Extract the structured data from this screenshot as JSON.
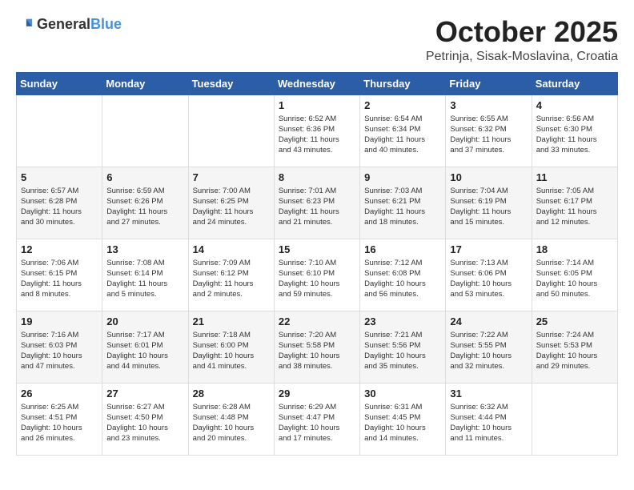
{
  "header": {
    "logo_general": "General",
    "logo_blue": "Blue",
    "month_title": "October 2025",
    "subtitle": "Petrinja, Sisak-Moslavina, Croatia"
  },
  "days_of_week": [
    "Sunday",
    "Monday",
    "Tuesday",
    "Wednesday",
    "Thursday",
    "Friday",
    "Saturday"
  ],
  "weeks": [
    [
      {
        "day": "",
        "info": ""
      },
      {
        "day": "",
        "info": ""
      },
      {
        "day": "",
        "info": ""
      },
      {
        "day": "1",
        "info": "Sunrise: 6:52 AM\nSunset: 6:36 PM\nDaylight: 11 hours\nand 43 minutes."
      },
      {
        "day": "2",
        "info": "Sunrise: 6:54 AM\nSunset: 6:34 PM\nDaylight: 11 hours\nand 40 minutes."
      },
      {
        "day": "3",
        "info": "Sunrise: 6:55 AM\nSunset: 6:32 PM\nDaylight: 11 hours\nand 37 minutes."
      },
      {
        "day": "4",
        "info": "Sunrise: 6:56 AM\nSunset: 6:30 PM\nDaylight: 11 hours\nand 33 minutes."
      }
    ],
    [
      {
        "day": "5",
        "info": "Sunrise: 6:57 AM\nSunset: 6:28 PM\nDaylight: 11 hours\nand 30 minutes."
      },
      {
        "day": "6",
        "info": "Sunrise: 6:59 AM\nSunset: 6:26 PM\nDaylight: 11 hours\nand 27 minutes."
      },
      {
        "day": "7",
        "info": "Sunrise: 7:00 AM\nSunset: 6:25 PM\nDaylight: 11 hours\nand 24 minutes."
      },
      {
        "day": "8",
        "info": "Sunrise: 7:01 AM\nSunset: 6:23 PM\nDaylight: 11 hours\nand 21 minutes."
      },
      {
        "day": "9",
        "info": "Sunrise: 7:03 AM\nSunset: 6:21 PM\nDaylight: 11 hours\nand 18 minutes."
      },
      {
        "day": "10",
        "info": "Sunrise: 7:04 AM\nSunset: 6:19 PM\nDaylight: 11 hours\nand 15 minutes."
      },
      {
        "day": "11",
        "info": "Sunrise: 7:05 AM\nSunset: 6:17 PM\nDaylight: 11 hours\nand 12 minutes."
      }
    ],
    [
      {
        "day": "12",
        "info": "Sunrise: 7:06 AM\nSunset: 6:15 PM\nDaylight: 11 hours\nand 8 minutes."
      },
      {
        "day": "13",
        "info": "Sunrise: 7:08 AM\nSunset: 6:14 PM\nDaylight: 11 hours\nand 5 minutes."
      },
      {
        "day": "14",
        "info": "Sunrise: 7:09 AM\nSunset: 6:12 PM\nDaylight: 11 hours\nand 2 minutes."
      },
      {
        "day": "15",
        "info": "Sunrise: 7:10 AM\nSunset: 6:10 PM\nDaylight: 10 hours\nand 59 minutes."
      },
      {
        "day": "16",
        "info": "Sunrise: 7:12 AM\nSunset: 6:08 PM\nDaylight: 10 hours\nand 56 minutes."
      },
      {
        "day": "17",
        "info": "Sunrise: 7:13 AM\nSunset: 6:06 PM\nDaylight: 10 hours\nand 53 minutes."
      },
      {
        "day": "18",
        "info": "Sunrise: 7:14 AM\nSunset: 6:05 PM\nDaylight: 10 hours\nand 50 minutes."
      }
    ],
    [
      {
        "day": "19",
        "info": "Sunrise: 7:16 AM\nSunset: 6:03 PM\nDaylight: 10 hours\nand 47 minutes."
      },
      {
        "day": "20",
        "info": "Sunrise: 7:17 AM\nSunset: 6:01 PM\nDaylight: 10 hours\nand 44 minutes."
      },
      {
        "day": "21",
        "info": "Sunrise: 7:18 AM\nSunset: 6:00 PM\nDaylight: 10 hours\nand 41 minutes."
      },
      {
        "day": "22",
        "info": "Sunrise: 7:20 AM\nSunset: 5:58 PM\nDaylight: 10 hours\nand 38 minutes."
      },
      {
        "day": "23",
        "info": "Sunrise: 7:21 AM\nSunset: 5:56 PM\nDaylight: 10 hours\nand 35 minutes."
      },
      {
        "day": "24",
        "info": "Sunrise: 7:22 AM\nSunset: 5:55 PM\nDaylight: 10 hours\nand 32 minutes."
      },
      {
        "day": "25",
        "info": "Sunrise: 7:24 AM\nSunset: 5:53 PM\nDaylight: 10 hours\nand 29 minutes."
      }
    ],
    [
      {
        "day": "26",
        "info": "Sunrise: 6:25 AM\nSunset: 4:51 PM\nDaylight: 10 hours\nand 26 minutes."
      },
      {
        "day": "27",
        "info": "Sunrise: 6:27 AM\nSunset: 4:50 PM\nDaylight: 10 hours\nand 23 minutes."
      },
      {
        "day": "28",
        "info": "Sunrise: 6:28 AM\nSunset: 4:48 PM\nDaylight: 10 hours\nand 20 minutes."
      },
      {
        "day": "29",
        "info": "Sunrise: 6:29 AM\nSunset: 4:47 PM\nDaylight: 10 hours\nand 17 minutes."
      },
      {
        "day": "30",
        "info": "Sunrise: 6:31 AM\nSunset: 4:45 PM\nDaylight: 10 hours\nand 14 minutes."
      },
      {
        "day": "31",
        "info": "Sunrise: 6:32 AM\nSunset: 4:44 PM\nDaylight: 10 hours\nand 11 minutes."
      },
      {
        "day": "",
        "info": ""
      }
    ]
  ]
}
